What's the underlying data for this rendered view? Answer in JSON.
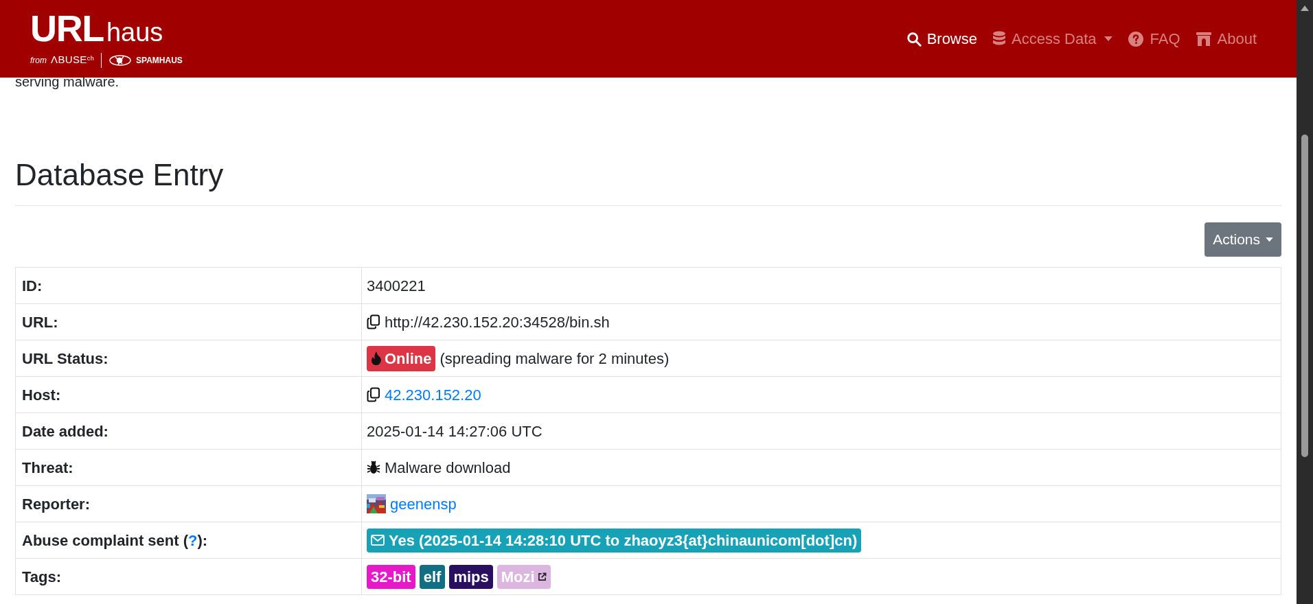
{
  "header": {
    "logo": {
      "main": "URL",
      "sub": "haus",
      "from": "from",
      "abuse": "ΛBUSE",
      "abuse_sup": "ch",
      "partner": "SPAMHAUS"
    },
    "nav": [
      {
        "label": "Browse",
        "selected": true,
        "dropdown": false
      },
      {
        "label": "Access Data",
        "selected": false,
        "dropdown": true
      },
      {
        "label": "FAQ",
        "selected": false,
        "dropdown": false
      },
      {
        "label": "About",
        "selected": false,
        "dropdown": false
      }
    ]
  },
  "intro_tail": "serving malware.",
  "heading": "Database Entry",
  "actions_button": "Actions",
  "rows": [
    {
      "label": "ID:",
      "kind": "text",
      "value": "3400221"
    },
    {
      "label": "URL:",
      "kind": "copy",
      "value": "http://42.230.152.20:34528/bin.sh"
    },
    {
      "label": "URL Status:",
      "kind": "status",
      "status": "Online",
      "value": "(spreading malware for 2 minutes)"
    },
    {
      "label": "Host:",
      "kind": "copy_link",
      "value": "42.230.152.20"
    },
    {
      "label": "Date added:",
      "kind": "text",
      "value": "2025-01-14 14:27:06 UTC"
    },
    {
      "label": "Threat:",
      "kind": "threat",
      "value": "Malware download"
    },
    {
      "label": "Reporter:",
      "kind": "reporter",
      "value": "geenensp"
    },
    {
      "label": "Abuse complaint sent (",
      "label_link": "?",
      "label_after": "):",
      "kind": "complaint",
      "value": "Yes (2025-01-14 14:28:10 UTC to zhaoyz3{at}chinaunicom[dot]cn)"
    },
    {
      "label": "Tags:",
      "kind": "tags",
      "tags": [
        {
          "text": "32-bit",
          "color": "#e619c9",
          "external": false
        },
        {
          "text": "elf",
          "color": "#126e82",
          "external": false
        },
        {
          "text": "mips",
          "color": "#2a0e60",
          "external": false
        },
        {
          "text": "Mozi",
          "color": "#dcb6e0",
          "external": true
        }
      ]
    }
  ]
}
